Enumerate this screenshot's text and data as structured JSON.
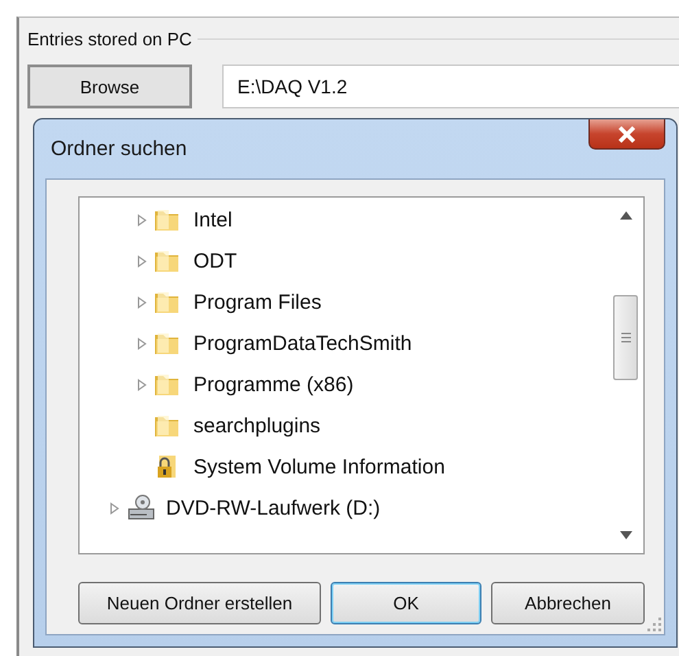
{
  "group": {
    "title": "Entries stored on PC"
  },
  "browse_button": {
    "label": "Browse"
  },
  "path_field": {
    "value": "E:\\DAQ V1.2"
  },
  "dialog": {
    "title": "Ordner suchen",
    "tree": {
      "items": [
        {
          "children": [
            {
              "label": "Intel",
              "kind": "folder",
              "expandable": true
            },
            {
              "label": "ODT",
              "kind": "folder",
              "expandable": true
            },
            {
              "label": "Program Files",
              "kind": "folder",
              "expandable": true
            },
            {
              "label": "ProgramDataTechSmith",
              "kind": "folder",
              "expandable": true
            },
            {
              "label": "Programme (x86)",
              "kind": "folder",
              "expandable": true
            },
            {
              "label": "searchplugins",
              "kind": "folder",
              "expandable": false
            },
            {
              "label": "System Volume Information",
              "kind": "locked-folder",
              "expandable": false
            }
          ]
        },
        {
          "label": "DVD-RW-Laufwerk (D:)",
          "kind": "drive",
          "expandable": true
        }
      ]
    },
    "buttons": [
      {
        "label": "Neuen Ordner erstellen",
        "default": false
      },
      {
        "label": "OK",
        "default": true
      },
      {
        "label": "Abbrechen",
        "default": false
      }
    ]
  }
}
